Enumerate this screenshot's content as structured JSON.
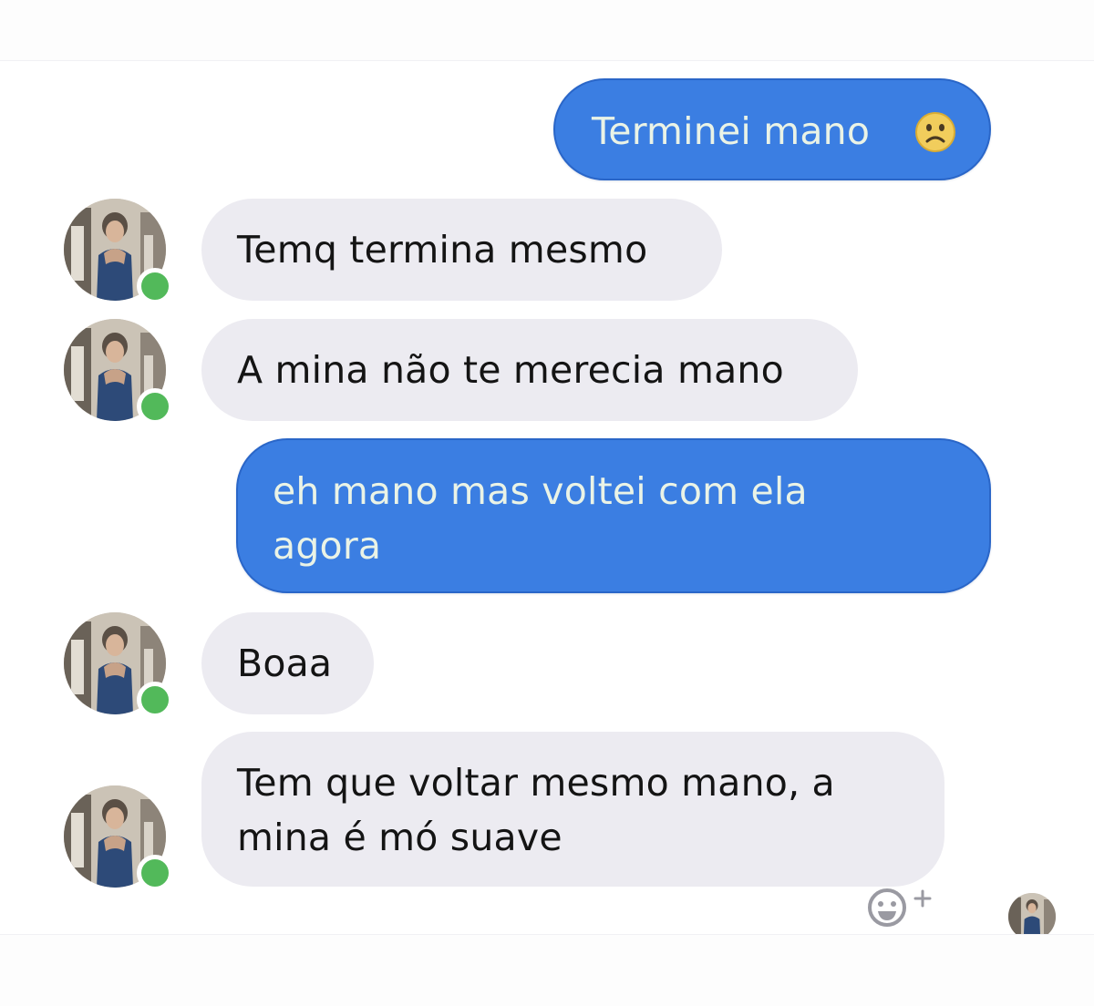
{
  "colors": {
    "sent_bubble": "#3b7ee2",
    "sent_text": "#eaf3e6",
    "received_bubble": "#ecebf1",
    "received_text": "#141414",
    "online_dot": "#52b95a"
  },
  "messages": [
    {
      "direction": "sent",
      "text": "Terminei mano",
      "emoji": "frowning-face-emoji"
    },
    {
      "direction": "received",
      "text": "Temq termina mesmo",
      "avatar": "contact-avatar",
      "online": true
    },
    {
      "direction": "received",
      "text": "A mina não te merecia mano",
      "avatar": "contact-avatar",
      "online": true
    },
    {
      "direction": "sent",
      "text": "eh mano mas voltei com ela\nagora"
    },
    {
      "direction": "received",
      "text": "Boaa",
      "avatar": "contact-avatar",
      "online": true
    },
    {
      "direction": "received",
      "text": "Tem que voltar mesmo mano, a\nmina é mó suave",
      "avatar": "contact-avatar",
      "online": true
    }
  ],
  "footer": {
    "reaction_icon": "add-reaction-icon",
    "seen_avatar": "seen-indicator-avatar"
  }
}
